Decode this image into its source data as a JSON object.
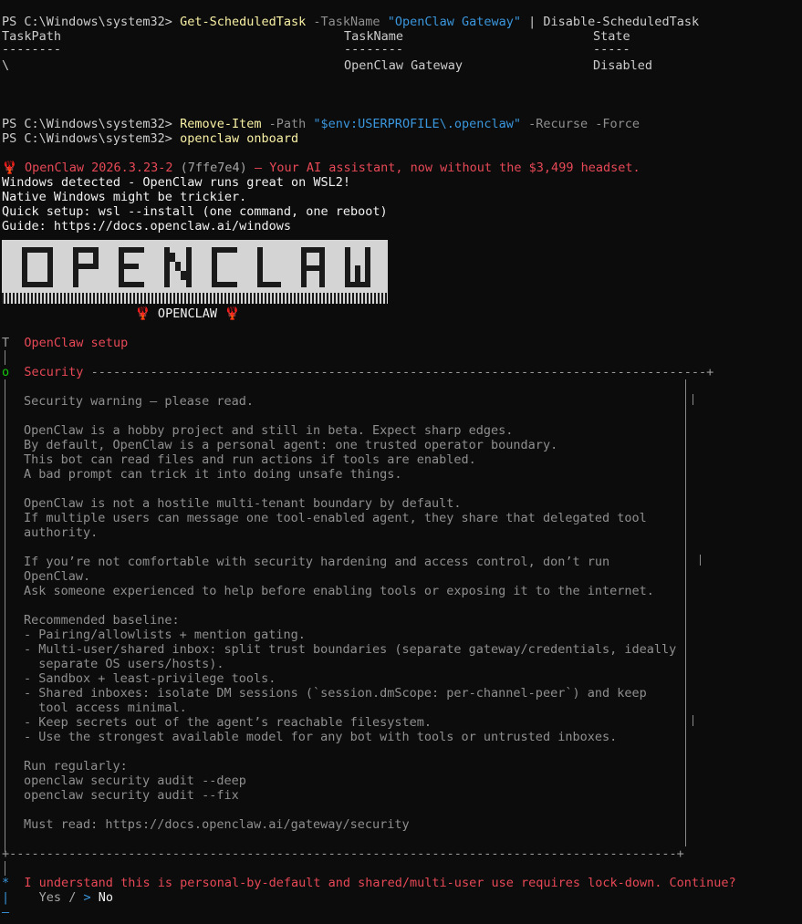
{
  "ps": {
    "prompt": "PS C:\\Windows\\system32>",
    "cmd1": {
      "a": "Get-ScheduledTask",
      "b": "-TaskName",
      "c": "\"OpenClaw Gateway\"",
      "d": "| Disable-ScheduledTask"
    },
    "table": {
      "headers": [
        "TaskPath",
        "TaskName",
        "State"
      ],
      "dashes": [
        "--------",
        "--------",
        "-----"
      ],
      "row": [
        "\\",
        "OpenClaw Gateway",
        "Disabled"
      ]
    },
    "cmd2": {
      "a": "Remove-Item",
      "b": "-Path",
      "c": "\"$env:USERPROFILE\\.openclaw\"",
      "d": "-Recurse -Force"
    },
    "cmd3": "openclaw onboard"
  },
  "openclaw": {
    "emoji": "🦞",
    "title": "OpenClaw 2026.3.23-2",
    "hash": "(7ffe7e4)",
    "tagline": "— Your AI assistant, now without the $3,499 headset.",
    "win": [
      "Windows detected - OpenClaw runs great on WSL2!",
      "Native Windows might be trickier.",
      "Quick setup: wsl --install (one command, one reboot)",
      "Guide: https://docs.openclaw.ai/windows"
    ],
    "banner_caption": "🦞 OPENCLAW 🦞",
    "setup_title": "OpenClaw setup",
    "security_title": "Security",
    "security_lines": [
      "Security warning — please read.",
      "",
      "OpenClaw is a hobby project and still in beta. Expect sharp edges.",
      "By default, OpenClaw is a personal agent: one trusted operator boundary.",
      "This bot can read files and run actions if tools are enabled.",
      "A bad prompt can trick it into doing unsafe things.",
      "",
      "OpenClaw is not a hostile multi-tenant boundary by default.",
      "If multiple users can message one tool-enabled agent, they share that delegated tool",
      "authority.",
      "",
      "If you’re not comfortable with security hardening and access control, don’t run",
      "OpenClaw.",
      "Ask someone experienced to help before enabling tools or exposing it to the internet.",
      "",
      "Recommended baseline:",
      "- Pairing/allowlists + mention gating.",
      "- Multi-user/shared inbox: split trust boundaries (separate gateway/credentials, ideally",
      "  separate OS users/hosts).",
      "- Sandbox + least-privilege tools.",
      "- Shared inboxes: isolate DM sessions (`session.dmScope: per-channel-peer`) and keep",
      "  tool access minimal.",
      "- Keep secrets out of the agent’s reachable filesystem.",
      "- Use the strongest available model for any bot with tools or untrusted inboxes.",
      "",
      "Run regularly:",
      "openclaw security audit --deep",
      "openclaw security audit --fix",
      "",
      "Must read: https://docs.openclaw.ai/gateway/security"
    ],
    "question": "I understand this is personal-by-default and shared/multi-user use requires lock-down. Continue?",
    "yes": "Yes",
    "sep": "/",
    "cursor": ">",
    "no": "No"
  },
  "colors": {
    "background": "#0c0c0c",
    "text": "#cccccc",
    "accent_red": "#e74856",
    "cyan": "#3a96dd",
    "green": "#16c60c"
  }
}
